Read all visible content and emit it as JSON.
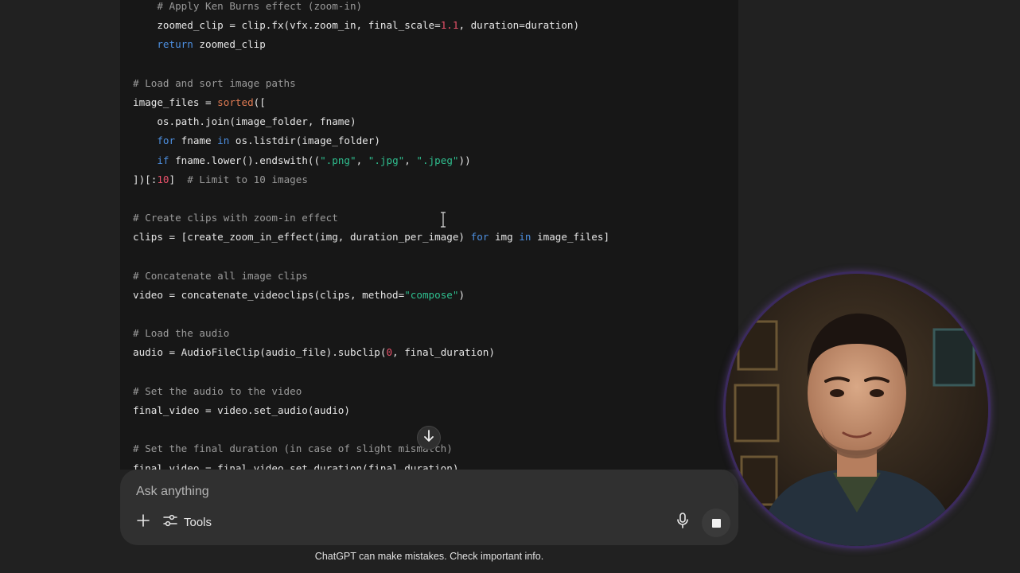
{
  "code_lines": [
    [
      {
        "t": "    "
      },
      {
        "t": "# Apply Ken Burns effect (zoom-in)",
        "c": "c"
      }
    ],
    [
      {
        "t": "    zoomed_clip = clip.fx(vfx.zoom_in, final_scale="
      },
      {
        "t": "1.1",
        "c": "n"
      },
      {
        "t": ", duration=duration)"
      }
    ],
    [
      {
        "t": "    "
      },
      {
        "t": "return",
        "c": "k"
      },
      {
        "t": " zoomed_clip"
      }
    ],
    [
      {
        "t": ""
      }
    ],
    [
      {
        "t": "# Load and sort image paths",
        "c": "c"
      }
    ],
    [
      {
        "t": "image_files = "
      },
      {
        "t": "sorted",
        "c": "fn"
      },
      {
        "t": "(["
      }
    ],
    [
      {
        "t": "    os.path.join(image_folder, fname)"
      }
    ],
    [
      {
        "t": "    "
      },
      {
        "t": "for",
        "c": "k"
      },
      {
        "t": " fname "
      },
      {
        "t": "in",
        "c": "k"
      },
      {
        "t": " os.listdir(image_folder)"
      }
    ],
    [
      {
        "t": "    "
      },
      {
        "t": "if",
        "c": "k"
      },
      {
        "t": " fname.lower().endswith(("
      },
      {
        "t": "\".png\"",
        "c": "s"
      },
      {
        "t": ", "
      },
      {
        "t": "\".jpg\"",
        "c": "s"
      },
      {
        "t": ", "
      },
      {
        "t": "\".jpeg\"",
        "c": "s"
      },
      {
        "t": "))"
      }
    ],
    [
      {
        "t": "])[:"
      },
      {
        "t": "10",
        "c": "n"
      },
      {
        "t": "]  "
      },
      {
        "t": "# Limit to 10 images",
        "c": "c"
      }
    ],
    [
      {
        "t": ""
      }
    ],
    [
      {
        "t": "# Create clips with zoom-in effect",
        "c": "c"
      }
    ],
    [
      {
        "t": "clips = [create_zoom_in_effect(img, duration_per_image) "
      },
      {
        "t": "for",
        "c": "k"
      },
      {
        "t": " img "
      },
      {
        "t": "in",
        "c": "k"
      },
      {
        "t": " image_files]"
      }
    ],
    [
      {
        "t": ""
      }
    ],
    [
      {
        "t": "# Concatenate all image clips",
        "c": "c"
      }
    ],
    [
      {
        "t": "video = concatenate_videoclips(clips, method="
      },
      {
        "t": "\"compose\"",
        "c": "s"
      },
      {
        "t": ")"
      }
    ],
    [
      {
        "t": ""
      }
    ],
    [
      {
        "t": "# Load the audio",
        "c": "c"
      }
    ],
    [
      {
        "t": "audio = AudioFileClip(audio_file).subclip("
      },
      {
        "t": "0",
        "c": "n"
      },
      {
        "t": ", final_duration)"
      }
    ],
    [
      {
        "t": ""
      }
    ],
    [
      {
        "t": "# Set the audio to the video",
        "c": "c"
      }
    ],
    [
      {
        "t": "final_video = video.set_audio(audio)"
      }
    ],
    [
      {
        "t": ""
      }
    ],
    [
      {
        "t": "# Set the final duration (in case of slight mismatch)",
        "c": "c"
      }
    ],
    [
      {
        "t": "final_video = final_video.set_duration(final_duration)"
      }
    ]
  ],
  "composer": {
    "placeholder": "Ask anything",
    "tools_label": "Tools"
  },
  "icons": {
    "plus": "plus-icon",
    "tools": "sliders-icon",
    "mic": "microphone-icon",
    "stop": "stop-icon",
    "scroll": "arrow-down-icon"
  },
  "disclaimer": "ChatGPT can make mistakes. Check important info.",
  "colors": {
    "background": "#212121",
    "code_bg": "#171717",
    "comment": "#9a9a9a",
    "keyword": "#4d8fe0",
    "string": "#2fbf8f",
    "number": "#e8516a",
    "builtin": "#e07b53"
  }
}
